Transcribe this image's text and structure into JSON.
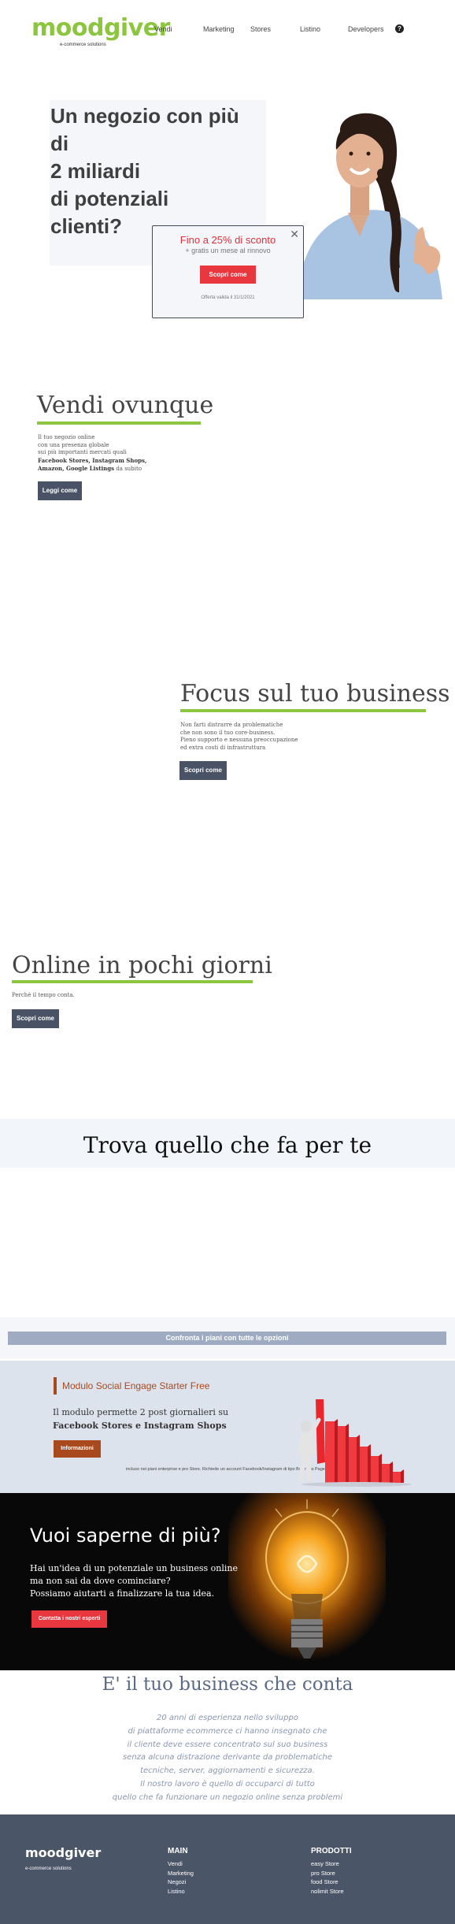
{
  "header": {
    "logo": "moodgiver",
    "logo_sub": "e-commerce solutions",
    "nav": [
      "Vendi",
      "Marketing",
      "Stores",
      "Listino",
      "Developers"
    ],
    "help": "?"
  },
  "hero": {
    "title_lines": [
      "Un negozio con più",
      "di",
      "2 miliardi",
      "di potenziali",
      "clienti?"
    ]
  },
  "popup": {
    "headline": "Fino a 25% di sconto",
    "sub": "+ gratis un mese al rinnovo",
    "button": "Scopri come",
    "footer": "Offerta valida il 31/1/2021",
    "close": "✕"
  },
  "sections": {
    "vendi": {
      "title": "Vendi ovunque",
      "body_1": "Il tuo negozio online",
      "body_2": "con una presenza globale",
      "body_3": "sui più importanti mercati quali",
      "body_4": "Facebook Stores, Instagram Shops,",
      "body_5a": "Amazon, Google Listings",
      "body_5b": " da subito",
      "button": "Leggi come"
    },
    "focus": {
      "title": "Focus sul tuo business",
      "body_1": "Non farti distrarre da problematiche",
      "body_2": "che non sono il tuo core-business.",
      "body_3": "Pieno supporto e nessuna preoccupazione",
      "body_4": "ed extra costi di infrastruttura",
      "button": "Scopri come"
    },
    "online": {
      "title": "Online in pochi giorni",
      "body_1": "Perchè il tempo conta.",
      "button": "Scopri come"
    }
  },
  "trova": {
    "title": "Trova quello che fa per te"
  },
  "compare": {
    "button": "Confronta i piani con tutte le opzioni"
  },
  "module": {
    "title": "Modulo Social Engage Starter Free",
    "body_1": "Il modulo permette 2 post giornalieri su",
    "body_2": "Facebook Stores e Instagram Shops",
    "button": "Informazioni",
    "note": "incluso nei piani enterprise e pro Store. Richiede un account Facebook/Instagram di tipo Business Page"
  },
  "dark": {
    "title": "Vuoi saperne di più?",
    "body_1": "Hai un'idea di un potenziale un business online",
    "body_2": "ma non sai da dove cominciare?",
    "body_3": "Possiamo aiutarti a finalizzare la tua idea.",
    "button": "Contatta i nostri esperti"
  },
  "business": {
    "title": "E' il tuo business che conta",
    "lines": [
      "20 anni di esperienza nello sviluppo",
      "di piattaforme ecommerce ci hanno insegnato che",
      "il cliente deve essere concentrato sul suo business",
      "senza alcuna distrazione derivante da problematiche",
      "tecniche, server, aggiornamenti e sicurezza.",
      "Il nostro lavoro è quello di occuparci di tutto",
      "quello che fa funzionare un negozio online senza problemi"
    ]
  },
  "footer": {
    "logo": "moodgiver",
    "logo_sub": "e-commerce solutions",
    "main_heading": "MAIN",
    "main_items": [
      "Vendi",
      "Marketing",
      "Negozi",
      "Listino"
    ],
    "products_heading": "PRODOTTI",
    "products_items": [
      "easy Store",
      "pro Store",
      "food Store",
      "nolimit Store"
    ]
  },
  "colors": {
    "brand_green": "#8cc63f",
    "dark_button": "#4a5366",
    "red_button": "#e8373f",
    "module_brown": "#a9491e",
    "footer_bg": "#4b5568"
  }
}
